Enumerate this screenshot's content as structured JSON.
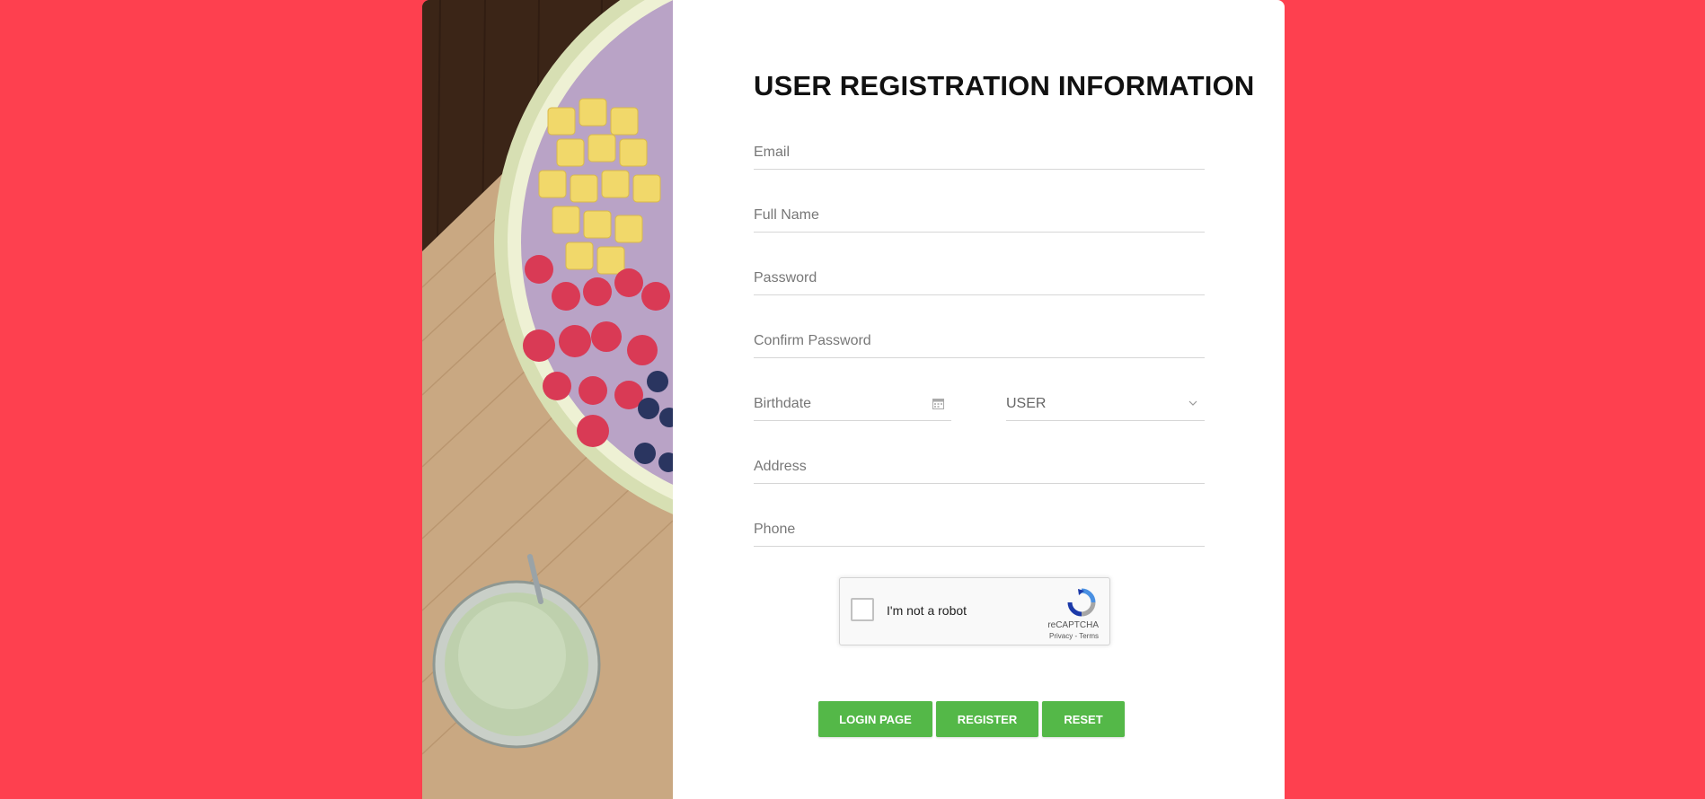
{
  "form": {
    "title": "USER REGISTRATION INFORMATION",
    "fields": {
      "email": {
        "placeholder": "Email",
        "value": ""
      },
      "full_name": {
        "placeholder": "Full Name",
        "value": ""
      },
      "password": {
        "placeholder": "Password",
        "value": ""
      },
      "confirm_password": {
        "placeholder": "Confirm Password",
        "value": ""
      },
      "birthdate": {
        "placeholder": "Birthdate",
        "value": ""
      },
      "role": {
        "selected": "USER"
      },
      "address": {
        "placeholder": "Address",
        "value": ""
      },
      "phone": {
        "placeholder": "Phone",
        "value": ""
      }
    }
  },
  "captcha": {
    "label": "I'm not a robot",
    "brand": "reCAPTCHA",
    "links": "Privacy - Terms",
    "checked": false
  },
  "buttons": {
    "login_page": "LOGIN PAGE",
    "register": "REGISTER",
    "reset": "RESET"
  },
  "colors": {
    "background": "#fe404f",
    "button": "#54b848",
    "card": "#ffffff"
  },
  "icons": {
    "birthdate": "calendar-icon",
    "role": "chevron-down-icon",
    "captcha": "recaptcha-logo-icon"
  }
}
